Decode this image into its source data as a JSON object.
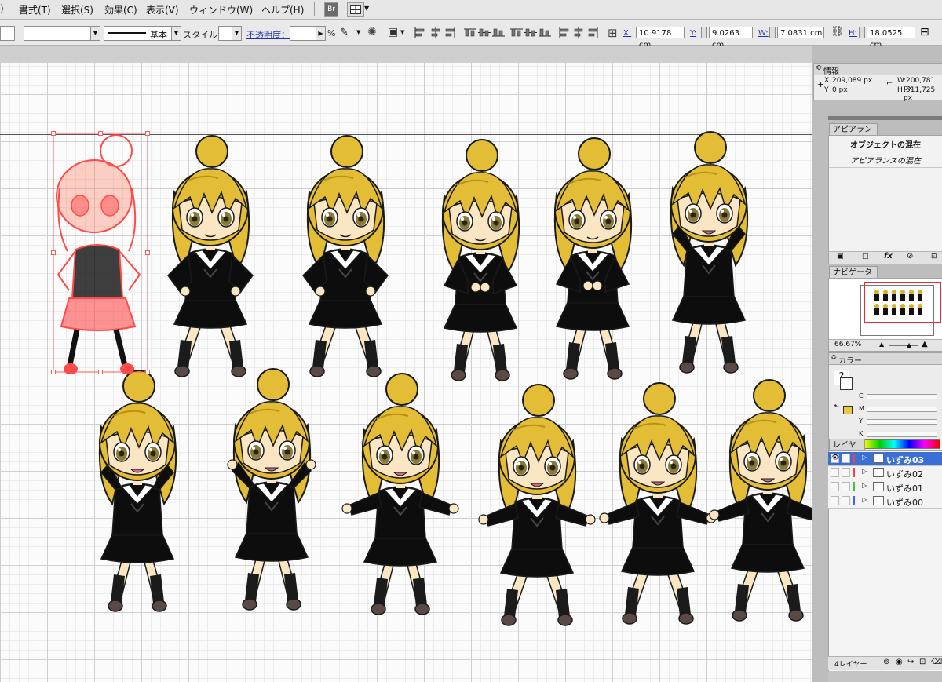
{
  "menu": {
    "items": [
      ")",
      "書式(T)",
      "選択(S)",
      "効果(C)",
      "表示(V)",
      "ウィンドウ(W)",
      "ヘルプ(H)"
    ],
    "br_button": "Br"
  },
  "control_bar": {
    "stroke_style_label": "基本",
    "style_label": "スタイル：",
    "opacity_label": "不透明度：",
    "opacity_unit": "%",
    "x_label": "X:",
    "x_value": "10.9178 cm",
    "y_label": "Y:",
    "y_value": "9.0263 cm",
    "w_label": "W:",
    "w_value": "7.0831 cm",
    "h_label": "H:",
    "h_value": "18.0525 cm"
  },
  "info_panel": {
    "title": "情報",
    "x_label": "X",
    "x_value": ":209,089 px",
    "y_label": "Y",
    "y_value": ":0 px",
    "w_label": "W",
    "w_value": ":200,781 px",
    "h_label": "H",
    "h_value": ":511,725 px"
  },
  "appearance_panel": {
    "tab": "アピアランス",
    "mixed_objects": "オブジェクトの混在",
    "mixed_appearance": "アピアランスの混在",
    "fx": "fx"
  },
  "navigator_panel": {
    "tab": "ナビゲーター",
    "zoom": "66.67%"
  },
  "color_panel": {
    "title": "カラー",
    "channels": [
      "C",
      "M",
      "Y",
      "K"
    ],
    "fill_color": "#e8c840"
  },
  "layers_panel": {
    "tab": "レイヤー",
    "layers": [
      {
        "name": "いずみ03",
        "selected": true,
        "color": "#ff4040"
      },
      {
        "name": "いずみ02",
        "selected": false,
        "color": "#ff4040"
      },
      {
        "name": "いずみ01",
        "selected": false,
        "color": "#40c040"
      },
      {
        "name": "いずみ00",
        "selected": false,
        "color": "#4060ff"
      }
    ],
    "count": "4レイヤー"
  },
  "figures": {
    "count": 12,
    "pose_names": [
      "hands-on-hips",
      "hands-on-hips",
      "hands-crossed",
      "hands-on-chest",
      "hands-on-cheeks",
      "hands-on-face",
      "hands-raised",
      "arms-spread",
      "arms-wide",
      "arms-wide",
      "arms-wide"
    ]
  }
}
